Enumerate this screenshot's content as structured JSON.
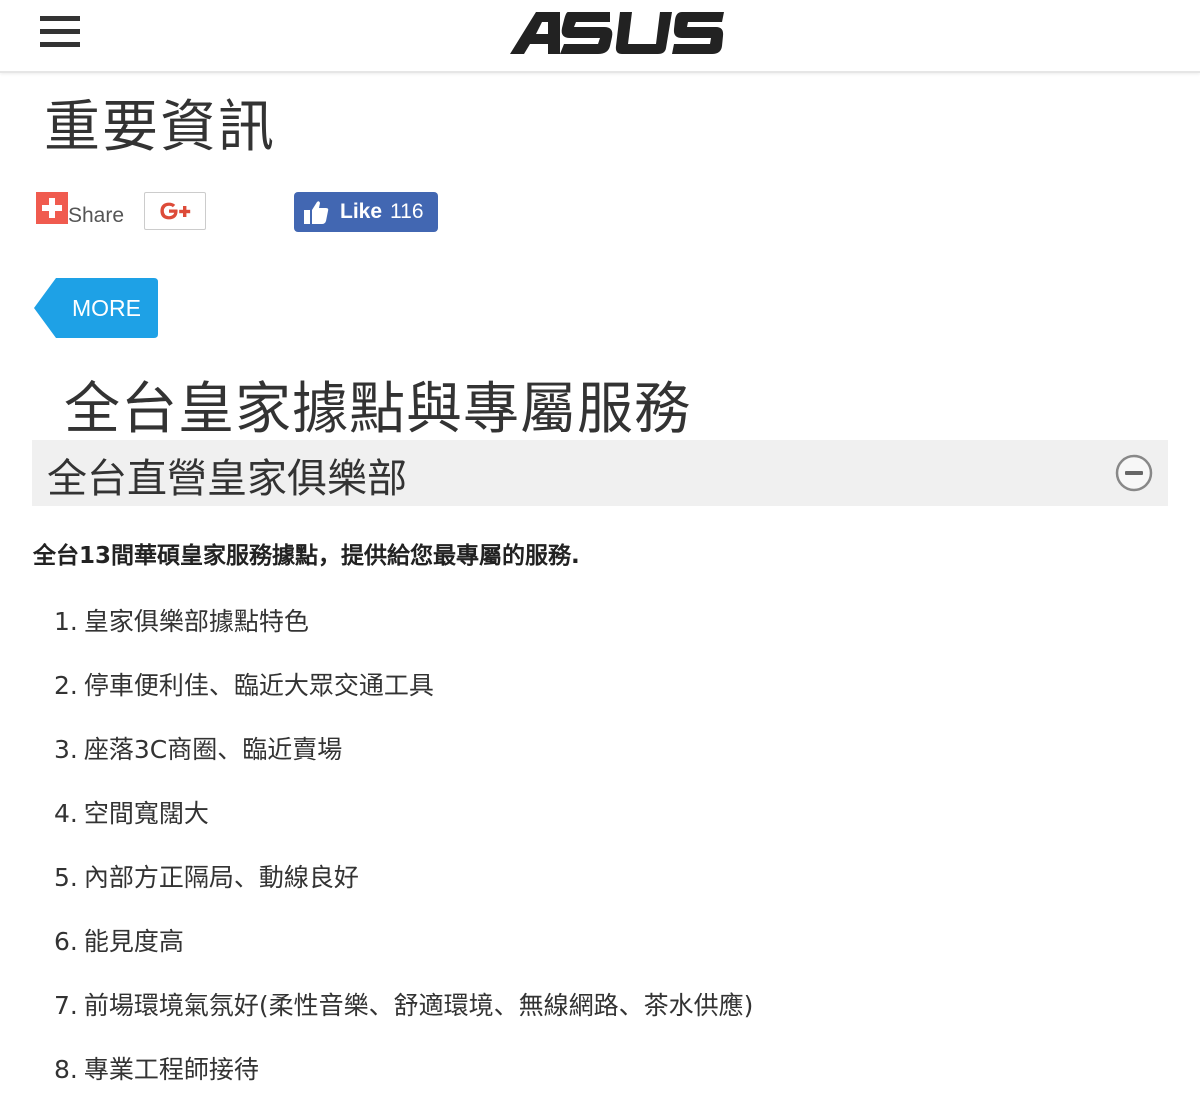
{
  "header": {
    "logo_text": "ASUS",
    "menu_icon": "hamburger-menu-icon"
  },
  "page_title": "重要資訊",
  "social": {
    "share_label": "Share",
    "gplus_label": "G+",
    "like_label": "Like",
    "like_count": "116",
    "colors": {
      "share": "#f05b4f",
      "gplus": "#dd4b39",
      "facebook": "#4267b2"
    }
  },
  "more_button": {
    "label": "MORE",
    "color": "#1ea1e6"
  },
  "section_title": "全台皇家據點與專屬服務",
  "accordion": {
    "title": "全台直營皇家俱樂部",
    "expanded": true,
    "icon": "collapse-minus-icon"
  },
  "intro": "全台13間華碩皇家服務據點，提供給您最專屬的服務.",
  "features": [
    {
      "num": "1.",
      "text": "皇家俱樂部據點特色"
    },
    {
      "num": "2.",
      "text": "停車便利佳、臨近大眾交通工具"
    },
    {
      "num": "3.",
      "text": "座落3C商圈、臨近賣場"
    },
    {
      "num": "4.",
      "text": "空間寬闊大"
    },
    {
      "num": "5.",
      "text": "內部方正隔局、動線良好"
    },
    {
      "num": "6.",
      "text": "能見度高"
    },
    {
      "num": "7.",
      "text": "前場環境氣氛好(柔性音樂、舒適環境、無線網路、茶水供應)"
    },
    {
      "num": "8.",
      "text": "專業工程師接待"
    }
  ]
}
